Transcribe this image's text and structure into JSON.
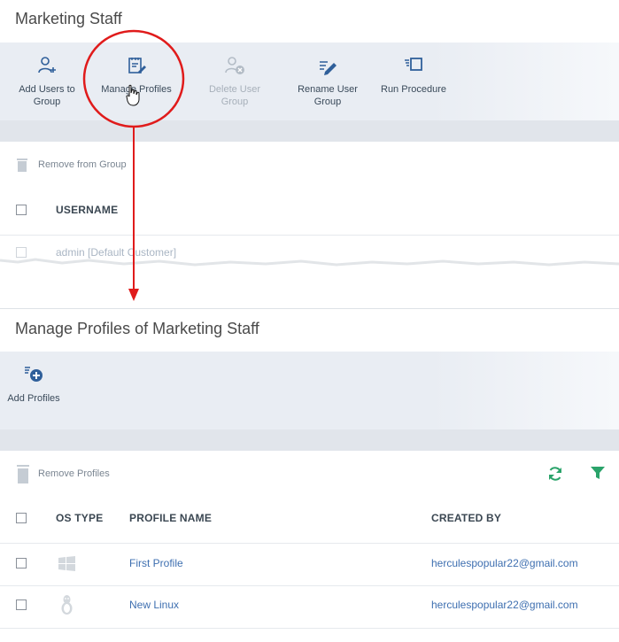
{
  "top": {
    "title": "Marketing Staff",
    "toolbar": [
      {
        "label_line1": "Add Users to",
        "label_line2": "Group",
        "icon": "add-user-icon",
        "disabled": false
      },
      {
        "label_line1": "Manage Profiles",
        "label_line2": "",
        "icon": "manage-profiles-icon",
        "disabled": false
      },
      {
        "label_line1": "Delete User",
        "label_line2": "Group",
        "icon": "delete-user-group-icon",
        "disabled": true
      },
      {
        "label_line1": "Rename User",
        "label_line2": "Group",
        "icon": "rename-pen-icon",
        "disabled": false
      },
      {
        "label_line1": "Run Procedure",
        "label_line2": "",
        "icon": "run-procedure-icon",
        "disabled": false
      }
    ],
    "remove_label": "Remove from Group",
    "column_username": "USERNAME",
    "rows": [
      {
        "username": "admin [Default Customer]"
      }
    ]
  },
  "bottom": {
    "title": "Manage Profiles of Marketing Staff",
    "add_profiles_label": "Add Profiles",
    "remove_profiles_label": "Remove Profiles",
    "columns": {
      "os_type": "OS TYPE",
      "profile_name": "PROFILE NAME",
      "created_by": "CREATED BY"
    },
    "rows": [
      {
        "os": "windows-icon",
        "profile_name": "First Profile",
        "created_by": "herculespopular22@gmail.com"
      },
      {
        "os": "linux-icon",
        "profile_name": "New Linux",
        "created_by": "herculespopular22@gmail.com"
      }
    ]
  },
  "colors": {
    "annotation_red": "#e01b1b",
    "link_blue": "#3e6fb0",
    "icon_blue": "#2f5f9a",
    "icon_green": "#2aa36a"
  }
}
